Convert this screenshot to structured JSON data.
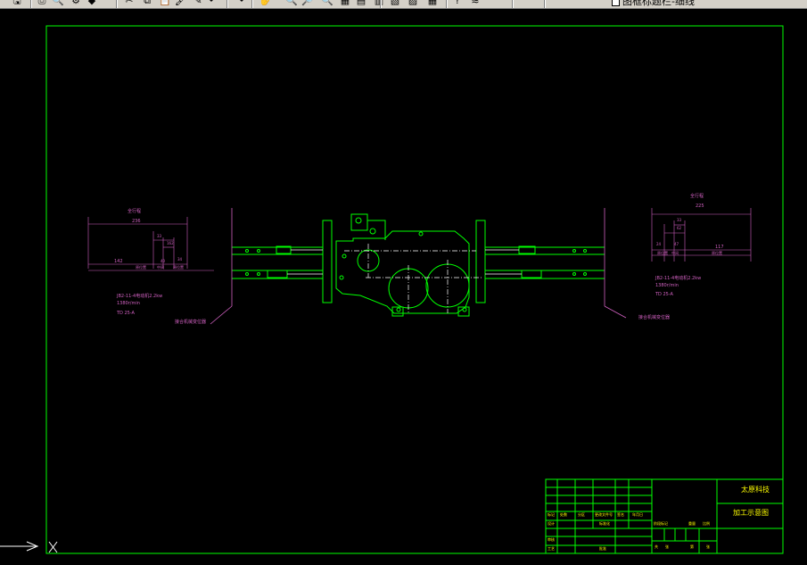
{
  "toolbar": {
    "buttons": [
      {
        "name": "save-icon",
        "glyph": "🖫"
      },
      {
        "name": "plot-icon",
        "glyph": "⎙"
      },
      {
        "name": "plot-preview-icon",
        "glyph": "🔍"
      },
      {
        "name": "publish-icon",
        "glyph": "⚙"
      },
      {
        "name": "3d-dwf-icon",
        "glyph": "◆"
      },
      {
        "name": "cut-icon",
        "glyph": "✂"
      },
      {
        "name": "copy-icon",
        "glyph": "⧉"
      },
      {
        "name": "paste-icon",
        "glyph": "📋"
      },
      {
        "name": "match-properties-icon",
        "glyph": "🖌"
      },
      {
        "name": "block-editor-icon",
        "glyph": "✎"
      },
      {
        "name": "undo-icon",
        "glyph": "↶"
      },
      {
        "name": "redo-icon",
        "glyph": "↷"
      },
      {
        "name": "pan-icon",
        "glyph": "✋"
      },
      {
        "name": "zoom-realtime-icon",
        "glyph": "🔍"
      },
      {
        "name": "zoom-window-icon",
        "glyph": "🔎"
      },
      {
        "name": "zoom-previous-icon",
        "glyph": "🔍"
      },
      {
        "name": "properties-icon",
        "glyph": "▦"
      },
      {
        "name": "design-center-icon",
        "glyph": "▤"
      },
      {
        "name": "tool-palettes-icon",
        "glyph": "▥"
      },
      {
        "name": "sheet-set-icon",
        "glyph": "▧"
      },
      {
        "name": "markup-icon",
        "glyph": "▨"
      },
      {
        "name": "quickcalc-icon",
        "glyph": "▦"
      },
      {
        "name": "help-icon",
        "glyph": "?"
      },
      {
        "name": "layer-manager-icon",
        "glyph": "≋"
      }
    ],
    "layer_name": "图框标题栏-细线"
  },
  "drawing": {
    "left_annotations": {
      "travel_label": "全行程",
      "dim_236": "236",
      "dim_33": "33",
      "dim_162": "162",
      "dim_142": "142",
      "dim_40": "40",
      "dim_34": "34",
      "label_side_a": "原位置",
      "label_side_b": "原位置",
      "label_mid": "中间",
      "motor": "JB2-11-4电动机2.2kw",
      "speed": "1380r/min",
      "coupling": "TD 25-A",
      "leader_note": "接合机械变位器"
    },
    "right_annotations": {
      "travel_label": "全行程",
      "dim_225": "225",
      "dim_33": "33",
      "dim_24": "24",
      "dim_62": "62",
      "dim_47": "47",
      "dim_117": "117",
      "label_side_a": "原位置",
      "label_side_b": "原位置",
      "label_mid": "中间",
      "motor": "JB2-11-4电动机2.2kw",
      "speed": "1380r/min",
      "coupling": "TD 25-A",
      "leader_note": "接合机械变位器"
    },
    "title_block": {
      "school": "太原科技",
      "drawing_title": "加工示意图",
      "rows": [
        "标记",
        "处数",
        "分区",
        "更改文件号",
        "签名",
        "年月日"
      ],
      "design": "设计",
      "standardize": "标准化",
      "review": "审核",
      "craft": "工艺",
      "approve": "批准",
      "stage_mark": "阶段标记",
      "weight": "重量",
      "scale": "比例",
      "sheet_total": "共",
      "sheet_num": "张",
      "sheet_of": "第",
      "sheet_unit": "张"
    }
  },
  "colors": {
    "frame": "#00ff00",
    "dimension": "#d060c0",
    "geometry": "#00ff00",
    "text_main": "#ffff00",
    "centerline": "#ffffff"
  }
}
